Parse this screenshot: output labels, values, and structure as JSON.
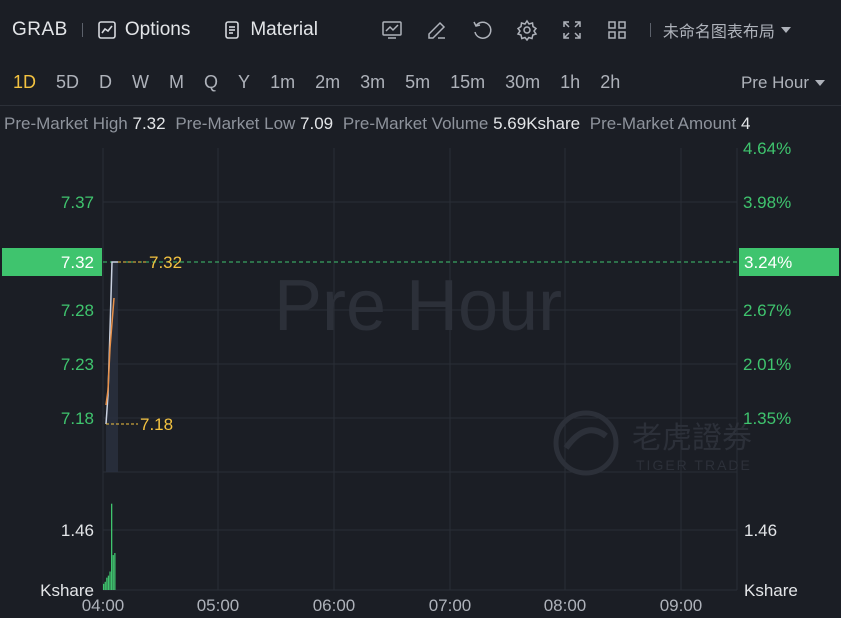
{
  "toolbar": {
    "ticker": "GRAB",
    "options_label": "Options",
    "material_label": "Material",
    "layout_name": "未命名图表布局",
    "icons": [
      "chart-indicator-icon",
      "draw-pen-icon",
      "refresh-icon",
      "gear-icon",
      "fullscreen-icon",
      "grid-layout-icon"
    ]
  },
  "periods": {
    "items": [
      "1D",
      "5D",
      "D",
      "W",
      "M",
      "Q",
      "Y",
      "1m",
      "2m",
      "3m",
      "5m",
      "15m",
      "30m",
      "1h",
      "2h"
    ],
    "active": "1D",
    "session": "Pre Hour"
  },
  "info": {
    "high_label": "Pre-Market High",
    "high_value": "7.32",
    "low_label": "Pre-Market Low",
    "low_value": "7.09",
    "volume_label": "Pre-Market Volume",
    "volume_value": "5.69Kshare",
    "amount_label": "Pre-Market Amount",
    "amount_value": "4"
  },
  "chart_data": {
    "type": "line",
    "watermark": "Pre Hour",
    "brand_cn": "老虎證券",
    "brand_en": "TIGER TRADE",
    "price_ticks": [
      "7.37",
      "7.28",
      "7.23",
      "7.18"
    ],
    "percent_ticks": [
      "4.64%",
      "3.98%",
      "2.67%",
      "2.01%",
      "1.35%"
    ],
    "current_price": "7.32",
    "current_percent": "3.24%",
    "high_marker": "7.32",
    "low_marker": "7.18",
    "x_ticks": [
      "04:00",
      "05:00",
      "06:00",
      "07:00",
      "08:00",
      "09:00"
    ],
    "volume_tick_left": "1.46",
    "volume_tick_right": "1.46",
    "volume_unit_left": "Kshare",
    "volume_unit_right": "Kshare",
    "price_line": [
      {
        "t": "04:00",
        "price": 7.18
      },
      {
        "t": "04:02",
        "price": 7.2
      },
      {
        "t": "04:03",
        "price": 7.27
      },
      {
        "t": "04:05",
        "price": 7.32
      },
      {
        "t": "04:06",
        "price": 7.32
      }
    ],
    "avg_line": [
      {
        "t": "04:00",
        "price": 7.19
      },
      {
        "t": "04:02",
        "price": 7.21
      },
      {
        "t": "04:03",
        "price": 7.25
      },
      {
        "t": "04:04",
        "price": 7.29
      }
    ],
    "volumes": [
      0.15,
      0.2,
      0.3,
      0.35,
      0.45,
      2.1,
      0.85,
      0.9
    ],
    "colors": {
      "up": "#3fc46e",
      "accent": "#f3c240",
      "avg": "#e8914a",
      "price": "#c9d1e0"
    }
  }
}
